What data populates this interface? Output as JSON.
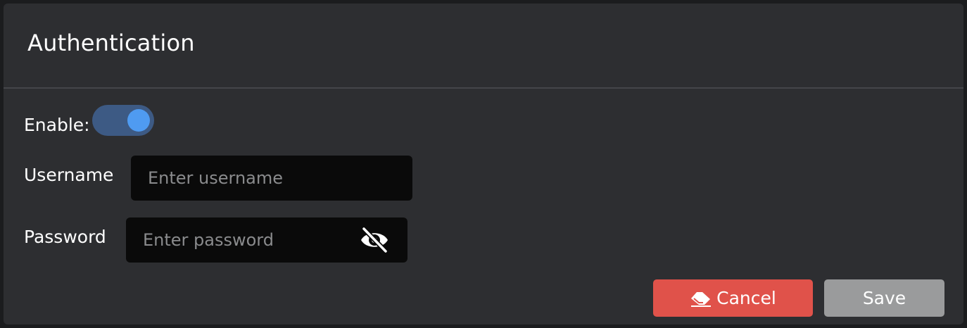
{
  "dialog": {
    "title": "Authentication"
  },
  "enable": {
    "label": "Enable:",
    "on": true,
    "track_color": "#3d5a84",
    "knob_color": "#4f9bf1"
  },
  "username": {
    "label": "Username",
    "value": "",
    "placeholder": "Enter username"
  },
  "password": {
    "label": "Password",
    "value": "",
    "placeholder": "Enter password",
    "visibility_icon": "eye-slash-icon"
  },
  "actions": {
    "cancel_label": "Cancel",
    "cancel_icon": "eraser-icon",
    "cancel_color": "#e0524a",
    "save_label": "Save",
    "save_color": "#9a9b9c"
  }
}
